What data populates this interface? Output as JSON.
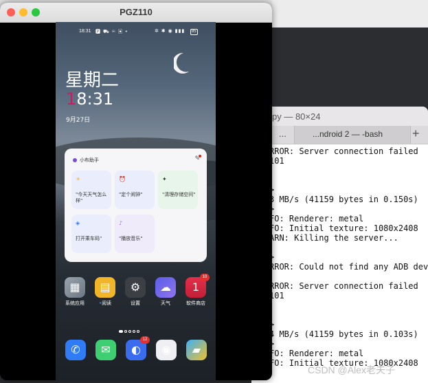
{
  "window": {
    "title": "PGZ110"
  },
  "terminal": {
    "title": "py — 80×24",
    "tab_more": "...",
    "tab_label": "...ndroid 2 — -bash",
    "tab_plus": "+",
    "lines": [
      "RROR: Server connection failed",
      "101",
      "",
      "",
      ">",
      "3 MB/s (41159 bytes in 0.150s)",
      ">",
      "FO: Renderer: metal",
      "FO: Initial texture: 1080x2408",
      "ARN: Killing the server...",
      "",
      ">",
      "RROR: Could not find any ADB dev",
      "",
      "RROR: Server connection failed",
      "101",
      "",
      "",
      ">",
      "4 MB/s (41159 bytes in 0.103s)",
      ">",
      "FO: Renderer: metal",
      "FO: Initial texture: 1080x2408"
    ]
  },
  "phone": {
    "status_time": "18:31",
    "status_icons": "🅿 ⛟ ✉ ▣ •",
    "status_right": "✲ ✱ ◉ ▮▮▮",
    "battery": "85",
    "weekday": "星期二",
    "clock_first": "1",
    "clock_rest": "8:31",
    "date": "9月27日",
    "assistant": {
      "title": "小布助手",
      "edit_icon": "✎",
      "suggestions": [
        {
          "icon": "☀",
          "text": "\"今天天气怎么样\""
        },
        {
          "icon": "⏰",
          "text": "\"定个闹钟\""
        },
        {
          "icon": "✦",
          "text": "\"清理存储空间\""
        },
        {
          "icon": "◈",
          "text": "打开乘车码\""
        },
        {
          "icon": "♪",
          "text": "\"播放音乐\""
        }
      ]
    },
    "apps": [
      {
        "label": "系统应用",
        "glyph": "▦",
        "badge": ""
      },
      {
        "label": "阅读",
        "glyph": "▤",
        "badge": ""
      },
      {
        "label": "设置",
        "glyph": "⚙",
        "badge": ""
      },
      {
        "label": "天气",
        "glyph": "☁",
        "badge": ""
      },
      {
        "label": "软件商店",
        "glyph": "1",
        "badge": "10"
      }
    ],
    "dock": [
      {
        "glyph": "✆",
        "badge": ""
      },
      {
        "glyph": "✉",
        "badge": ""
      },
      {
        "glyph": "◐",
        "badge": "12"
      },
      {
        "glyph": "◉",
        "badge": ""
      },
      {
        "glyph": "▰",
        "badge": ""
      }
    ]
  },
  "watermark": "CSDN @Alex老夫子",
  "colors": {
    "accent_hour": "#d01960",
    "badge": "#e03030"
  }
}
